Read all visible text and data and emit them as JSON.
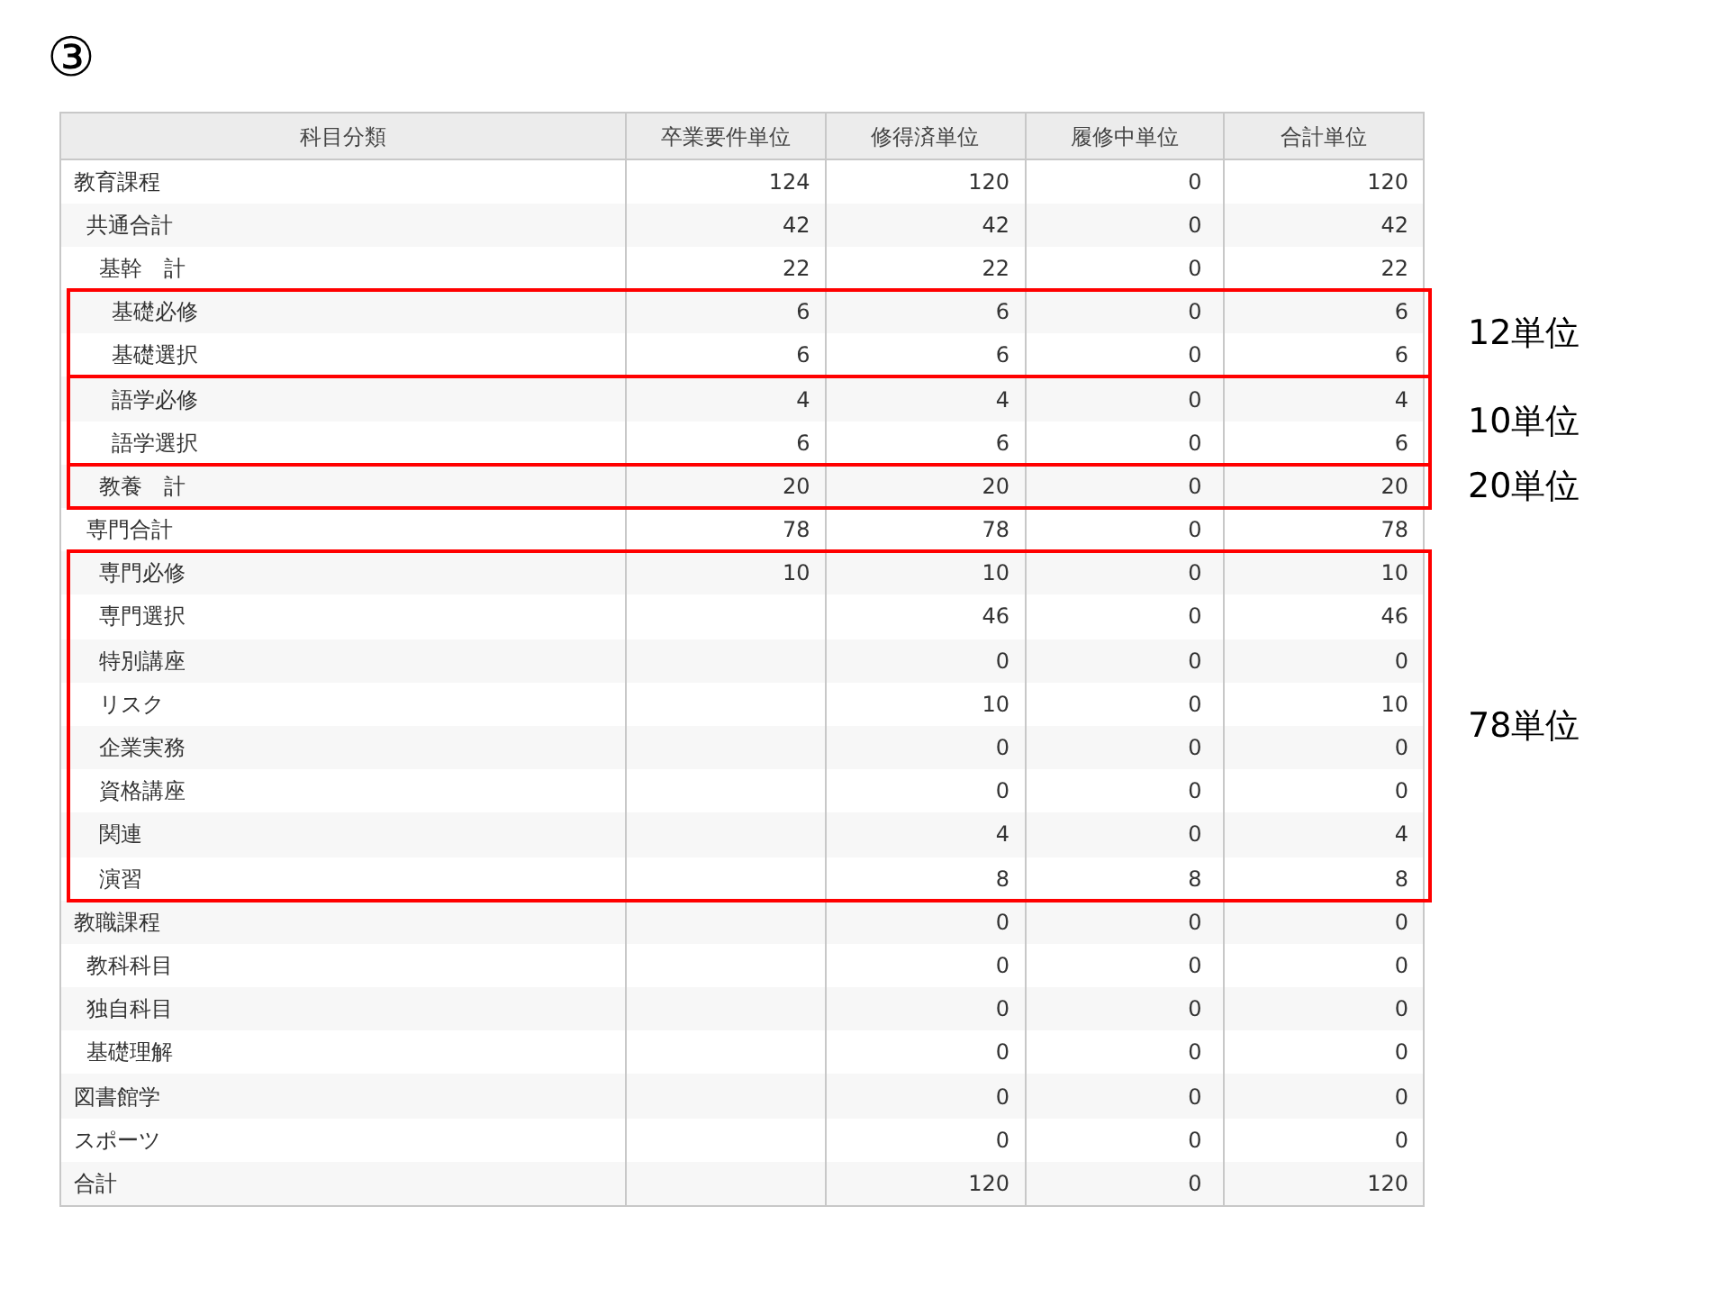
{
  "slide_number": "③",
  "table": {
    "columns": [
      "科目分類",
      "卒業要件単位",
      "修得済単位",
      "履修中単位",
      "合計単位"
    ],
    "rows": [
      {
        "category": "教育課程",
        "required": "124",
        "earned": "120",
        "in_progress": "0",
        "total": "120",
        "highlighted": false,
        "children": [
          {
            "category": "共通合計",
            "required": "42",
            "earned": "42",
            "in_progress": "0",
            "total": "42",
            "highlighted": false,
            "children": [
              {
                "category": "基幹　計",
                "required": "22",
                "earned": "22",
                "in_progress": "0",
                "total": "22",
                "highlighted": false,
                "children": [
                  {
                    "category": "基礎必修",
                    "required": "6",
                    "earned": "6",
                    "in_progress": "0",
                    "total": "6",
                    "highlighted": true,
                    "callout": "12単位"
                  },
                  {
                    "category": "基礎選択",
                    "required": "6",
                    "earned": "6",
                    "in_progress": "0",
                    "total": "6",
                    "highlighted": true
                  },
                  {
                    "category": "語学必修",
                    "required": "4",
                    "earned": "4",
                    "in_progress": "0",
                    "total": "4",
                    "highlighted": true,
                    "callout": "10単位"
                  },
                  {
                    "category": "語学選択",
                    "required": "6",
                    "earned": "6",
                    "in_progress": "0",
                    "total": "6",
                    "highlighted": true
                  }
                ]
              },
              {
                "category": "教養　計",
                "required": "20",
                "earned": "20",
                "in_progress": "0",
                "total": "20",
                "highlighted": true,
                "callout": "20単位"
              }
            ]
          },
          {
            "category": "専門合計",
            "required": "78",
            "earned": "78",
            "in_progress": "0",
            "total": "78",
            "highlighted": false,
            "children": [
              {
                "category": "専門必修",
                "required": "10",
                "earned": "10",
                "in_progress": "0",
                "total": "10",
                "highlighted": true,
                "callout": "78単位"
              },
              {
                "category": "専門選択",
                "earned": "46",
                "in_progress": "0",
                "total": "46",
                "highlighted": true
              },
              {
                "category": "特別講座",
                "earned": "0",
                "in_progress": "0",
                "total": "0",
                "highlighted": true
              },
              {
                "category": "リスク",
                "earned": "10",
                "in_progress": "0",
                "total": "10",
                "highlighted": true
              },
              {
                "category": "企業実務",
                "earned": "0",
                "in_progress": "0",
                "total": "0",
                "highlighted": true
              },
              {
                "category": "資格講座",
                "earned": "0",
                "in_progress": "0",
                "total": "0",
                "highlighted": true
              },
              {
                "category": "関連",
                "earned": "4",
                "in_progress": "0",
                "total": "4",
                "highlighted": true
              },
              {
                "category": "演習",
                "earned": "8",
                "in_progress": "8",
                "total": "8",
                "highlighted": true
              }
            ]
          }
        ]
      },
      {
        "category": "教職課程",
        "earned": "0",
        "in_progress": "0",
        "total": "0",
        "highlighted": false,
        "children": [
          {
            "category": "教科科目",
            "earned": "0",
            "in_progress": "0",
            "total": "0",
            "highlighted": false
          },
          {
            "category": "独自科目",
            "earned": "0",
            "in_progress": "0",
            "total": "0",
            "highlighted": false
          },
          {
            "category": "基礎理解",
            "earned": "0",
            "in_progress": "0",
            "total": "0",
            "highlighted": false
          }
        ]
      },
      {
        "category": "図書館学",
        "earned": "0",
        "in_progress": "0",
        "total": "0",
        "highlighted": false
      },
      {
        "category": "スポーツ",
        "earned": "0",
        "in_progress": "0",
        "total": "0",
        "highlighted": false
      },
      {
        "category": "合計",
        "earned": "120",
        "in_progress": "0",
        "total": "120",
        "highlighted": false
      }
    ]
  }
}
